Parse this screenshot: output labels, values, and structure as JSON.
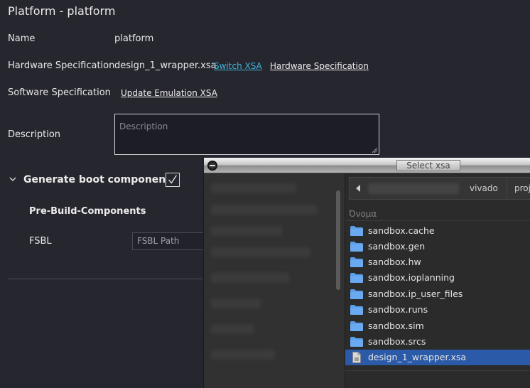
{
  "editor": {
    "title": "Platform - platform",
    "name_label": "Name",
    "name_value": "platform",
    "hw_label": "Hardware Specification",
    "hw_value": "design_1_wrapper.xsa",
    "switch_xsa": "Switch XSA",
    "hw_link": "Hardware Specification",
    "sw_label": "Software Specification",
    "sw_link": "Update Emulation XSA",
    "desc_label": "Description",
    "desc_placeholder": "Description",
    "section_title": "Generate boot components",
    "section_checked": true,
    "sub_title": "Pre-Build-Components",
    "fsbl_label": "FSBL",
    "fsbl_placeholder": "FSBL Path"
  },
  "dialog": {
    "title": "Select xsa",
    "path_segments": [
      "vivado",
      "proje"
    ],
    "column_header": "Όνομα",
    "files": [
      {
        "name": "sandbox.cache",
        "type": "folder"
      },
      {
        "name": "sandbox.gen",
        "type": "folder"
      },
      {
        "name": "sandbox.hw",
        "type": "folder"
      },
      {
        "name": "sandbox.ioplanning",
        "type": "folder"
      },
      {
        "name": "sandbox.ip_user_files",
        "type": "folder"
      },
      {
        "name": "sandbox.runs",
        "type": "folder"
      },
      {
        "name": "sandbox.sim",
        "type": "folder"
      },
      {
        "name": "sandbox.srcs",
        "type": "folder"
      },
      {
        "name": "design_1_wrapper.xsa",
        "type": "file",
        "selected": true
      }
    ]
  },
  "colors": {
    "background": "#26262f",
    "link_accent": "#3fb6d8",
    "selection": "#2a5aa8",
    "folder": "#5b9ee6"
  }
}
